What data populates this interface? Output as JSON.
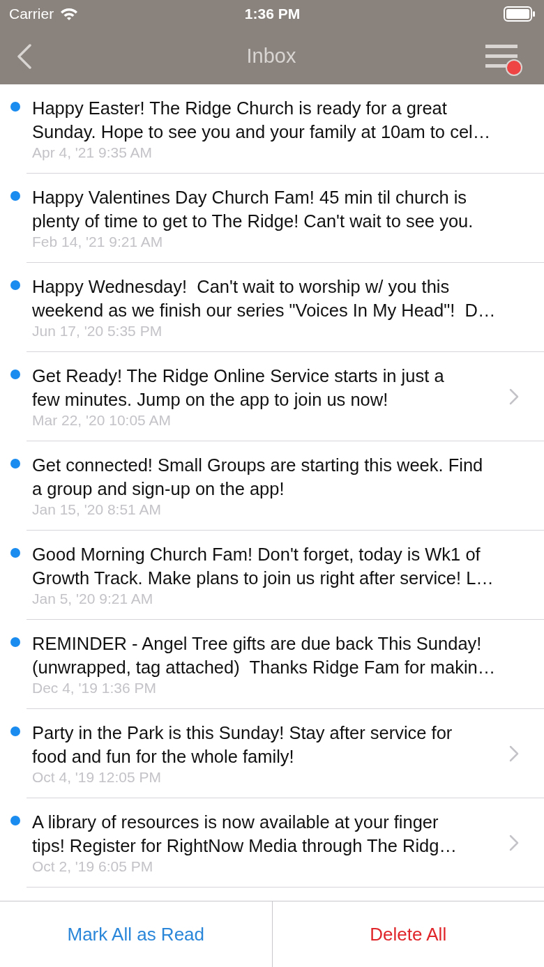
{
  "status_bar": {
    "carrier": "Carrier",
    "time": "1:36 PM"
  },
  "nav": {
    "title": "Inbox",
    "menu_badge": true
  },
  "messages": [
    {
      "unread": true,
      "lines": [
        "Happy Easter! The Ridge Church is ready for a great",
        "Sunday. Hope to see you and your family at 10am to cel…"
      ],
      "date": "Apr 4, '21 9:35 AM",
      "chevron": false
    },
    {
      "unread": true,
      "lines": [
        "Happy Valentines Day Church Fam! 45 min til church is",
        "plenty of time to get to The Ridge! Can't wait to see you."
      ],
      "date": "Feb 14, '21 9:21 AM",
      "chevron": false
    },
    {
      "unread": true,
      "lines": [
        "Happy Wednesday!  Can't wait to worship w/ you this",
        "weekend as we finish our series \"Voices In My Head\"!  D…"
      ],
      "date": "Jun 17, '20 5:35 PM",
      "chevron": false
    },
    {
      "unread": true,
      "lines": [
        "Get Ready! The Ridge Online Service starts in just a",
        "few minutes. Jump on the app to join us now!"
      ],
      "date": "Mar 22, '20 10:05 AM",
      "chevron": true
    },
    {
      "unread": true,
      "lines": [
        "Get connected! Small Groups are starting this week. Find",
        "a group and sign-up on the app!"
      ],
      "date": "Jan 15, '20 8:51 AM",
      "chevron": false
    },
    {
      "unread": true,
      "lines": [
        "Good Morning Church Fam! Don't forget, today is Wk1 of",
        "Growth Track. Make plans to join us right after service! L…"
      ],
      "date": "Jan 5, '20 9:21 AM",
      "chevron": false
    },
    {
      "unread": true,
      "lines": [
        "REMINDER - Angel Tree gifts are due back This Sunday!",
        "(unwrapped, tag attached)  Thanks Ridge Fam for makin…"
      ],
      "date": "Dec 4, '19 1:36 PM",
      "chevron": false
    },
    {
      "unread": true,
      "lines": [
        "Party in the Park is this Sunday! Stay after service for",
        "food and fun for the whole family!"
      ],
      "date": "Oct 4, '19 12:05 PM",
      "chevron": true
    },
    {
      "unread": true,
      "lines": [
        "A library of resources is now available at your finger",
        "tips! Register for RightNow Media through The Ridg…"
      ],
      "date": "Oct 2, '19 6:05 PM",
      "chevron": true
    }
  ],
  "actions": {
    "mark_all": "Mark All as Read",
    "delete_all": "Delete All"
  }
}
